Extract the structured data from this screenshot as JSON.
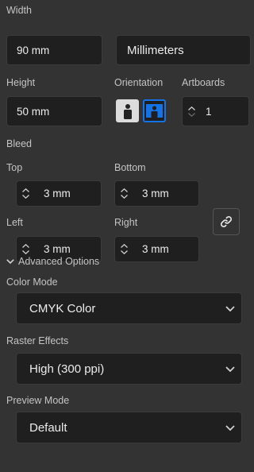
{
  "width": {
    "label": "Width",
    "value": "90 mm",
    "units": "Millimeters"
  },
  "height": {
    "label": "Height",
    "value": "50 mm"
  },
  "orientation": {
    "label": "Orientation",
    "selected": "landscape"
  },
  "artboards": {
    "label": "Artboards",
    "value": "1"
  },
  "bleed": {
    "label": "Bleed",
    "top": {
      "label": "Top",
      "value": "3 mm"
    },
    "bottom": {
      "label": "Bottom",
      "value": "3 mm"
    },
    "left": {
      "label": "Left",
      "value": "3 mm"
    },
    "right": {
      "label": "Right",
      "value": "3 mm"
    },
    "link_icon": "link-icon"
  },
  "advanced": {
    "label": "Advanced Options",
    "expanded": true
  },
  "color_mode": {
    "label": "Color Mode",
    "value": "CMYK Color"
  },
  "raster_effects": {
    "label": "Raster Effects",
    "value": "High (300 ppi)"
  },
  "preview_mode": {
    "label": "Preview Mode",
    "value": "Default"
  },
  "colors": {
    "panel_bg": "#333333",
    "field_bg": "#1f1f1f",
    "accent": "#1473e6"
  }
}
